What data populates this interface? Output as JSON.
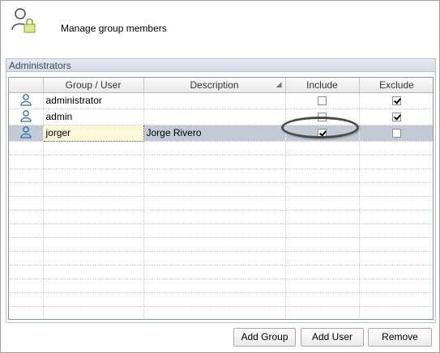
{
  "header": {
    "title": "Manage group members",
    "icon": "user-lock-icon"
  },
  "group": {
    "title": "Administrators"
  },
  "grid": {
    "columns": [
      "",
      "Group / User",
      "Description",
      "Include",
      "Exclude"
    ],
    "rows": [
      {
        "name": "administrator",
        "description": "",
        "include": false,
        "exclude": true,
        "icon": "user-icon",
        "selected": false
      },
      {
        "name": "admin",
        "description": "",
        "include": false,
        "exclude": true,
        "icon": "user-icon",
        "selected": false
      },
      {
        "name": "jorger",
        "description": "Jorge Rivero",
        "include": true,
        "exclude": false,
        "icon": "user-icon",
        "selected": true
      }
    ]
  },
  "buttons": {
    "add_group": "Add Group",
    "add_user": "Add User",
    "remove": "Remove"
  },
  "colors": {
    "selected_row": "#c2cad6",
    "group_header": "#dfe5ee",
    "edit_cell": "#fff7d9"
  }
}
